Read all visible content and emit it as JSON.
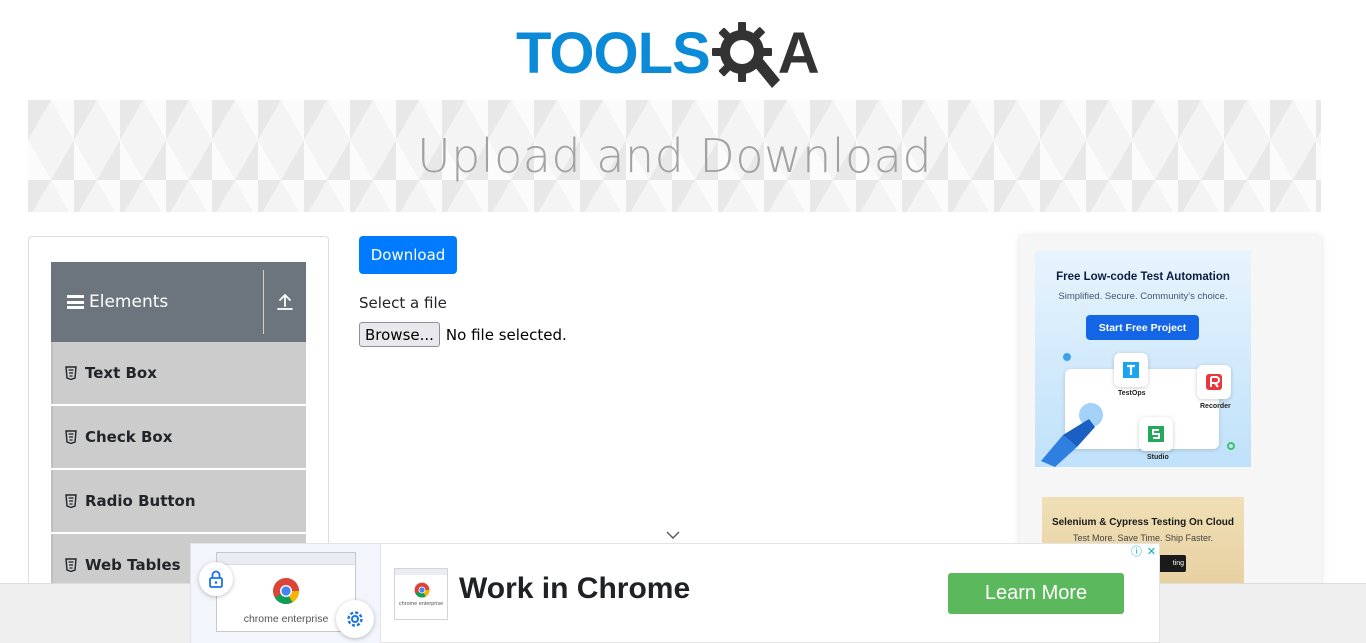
{
  "header": {
    "logo_text_left": "TOOLS",
    "logo_text_right": "A",
    "brand_color": "#0b8ad8"
  },
  "banner": {
    "title": "Upload and Download"
  },
  "sidebar": {
    "group_title": "Elements",
    "group_color": "#6c757d",
    "items": [
      {
        "label": "Text Box",
        "icon": "document-icon"
      },
      {
        "label": "Check Box",
        "icon": "document-icon"
      },
      {
        "label": "Radio Button",
        "icon": "document-icon"
      },
      {
        "label": "Web Tables",
        "icon": "document-icon"
      }
    ]
  },
  "main": {
    "download_label": "Download",
    "download_color": "#007bff",
    "select_label": "Select a file",
    "browse_label": "Browse...",
    "file_status": "No file selected."
  },
  "ads": {
    "katalon": {
      "title": "Free Low-code Test Automation",
      "subtitle": "Simplified. Secure. Community's choice.",
      "button": "Start Free Project",
      "apps": [
        "TestOps",
        "Recorder",
        "Studio"
      ]
    },
    "cloud": {
      "title": "Selenium & Cypress Testing On Cloud",
      "subtitle": "Test More. Save Time. Ship Faster.",
      "button": "ting"
    },
    "chrome": {
      "thumb_label": "chrome enterprise",
      "small_thumb_label": "chrome enterprise",
      "headline": "Work in Chrome",
      "button": "Learn More",
      "button_color": "#5cb85c"
    }
  }
}
